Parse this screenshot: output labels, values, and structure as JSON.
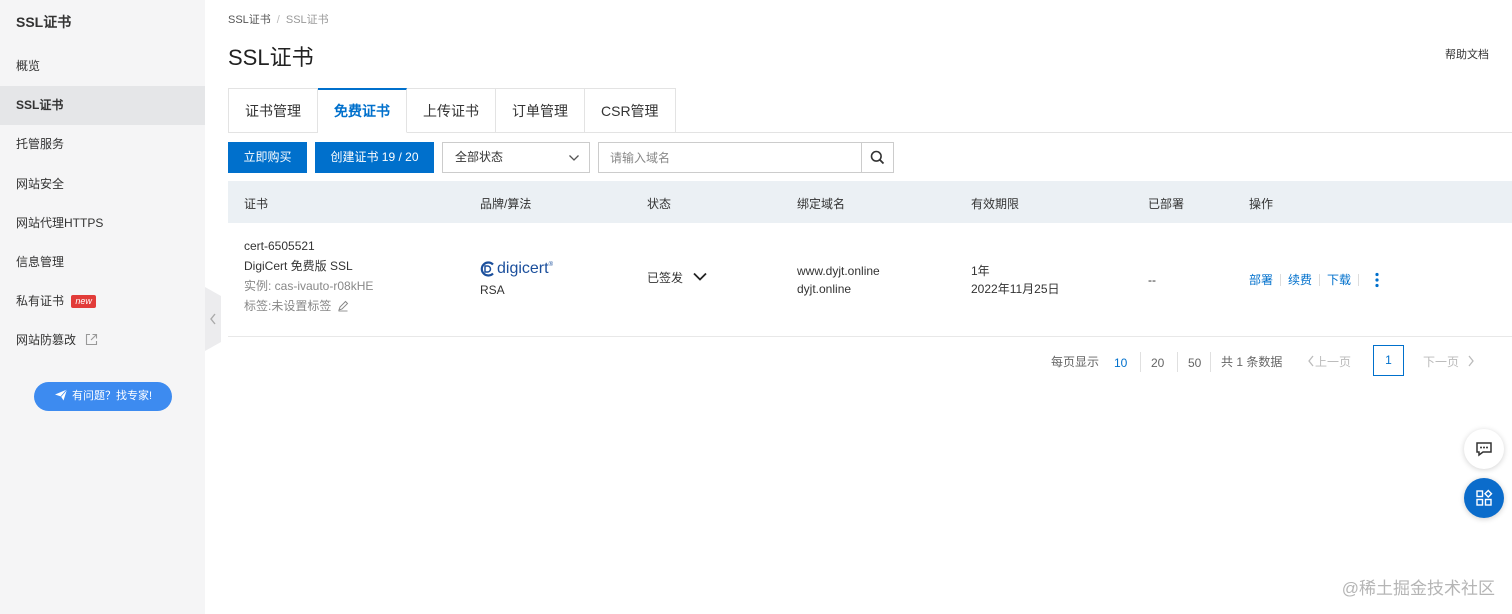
{
  "sidebar": {
    "title": "SSL证书",
    "items": [
      {
        "label": "概览"
      },
      {
        "label": "SSL证书"
      },
      {
        "label": "托管服务"
      },
      {
        "label": "网站安全"
      },
      {
        "label": "网站代理HTTPS"
      },
      {
        "label": "信息管理"
      },
      {
        "label": "私有证书",
        "badge": "new"
      },
      {
        "label": "网站防篡改",
        "icon": "external-link-icon"
      }
    ],
    "active_index": 1,
    "expert_button": "有问题？找专家!"
  },
  "breadcrumb": [
    "SSL证书",
    "SSL证书"
  ],
  "page_title": "SSL证书",
  "help_link": "帮助文档",
  "tabs": [
    {
      "label": "证书管理"
    },
    {
      "label": "免费证书"
    },
    {
      "label": "上传证书"
    },
    {
      "label": "订单管理"
    },
    {
      "label": "CSR管理"
    }
  ],
  "active_tab": "免费证书",
  "toolbar": {
    "buy_button": "立即购买",
    "create_button": "创建证书 19 / 20",
    "status_select": "全部状态",
    "search_placeholder": "请输入域名"
  },
  "table": {
    "columns": [
      "证书",
      "品牌/算法",
      "状态",
      "绑定域名",
      "有效期限",
      "已部署",
      "操作"
    ],
    "rows": [
      {
        "cert_id": "cert-6505521",
        "cert_name": "DigiCert 免费版 SSL",
        "instance": "实例: cas-ivauto-r08kHE",
        "tag": "标签:未设置标签",
        "brand": "digicert",
        "algorithm": "RSA",
        "status": "已签发",
        "domains": [
          "www.dyjt.online",
          "dyjt.online"
        ],
        "validity": "1年",
        "expiry": "2022年11月25日",
        "deployed": "--",
        "actions": [
          "部署",
          "续费",
          "下载"
        ]
      }
    ]
  },
  "pagination": {
    "per_page_label": "每页显示",
    "sizes": [
      "10",
      "20",
      "50"
    ],
    "active_size": "10",
    "total": "共 1 条数据",
    "prev": "上一页",
    "current_page": "1",
    "next": "下一页"
  },
  "watermark": "@稀土掘金技术社区",
  "colors": {
    "primary": "#0070cc",
    "sidebar_bg": "#f5f5f6",
    "table_header_bg": "#ebf0f4",
    "badge_red": "#e23c39",
    "expert_button": "#3d8bf0"
  }
}
